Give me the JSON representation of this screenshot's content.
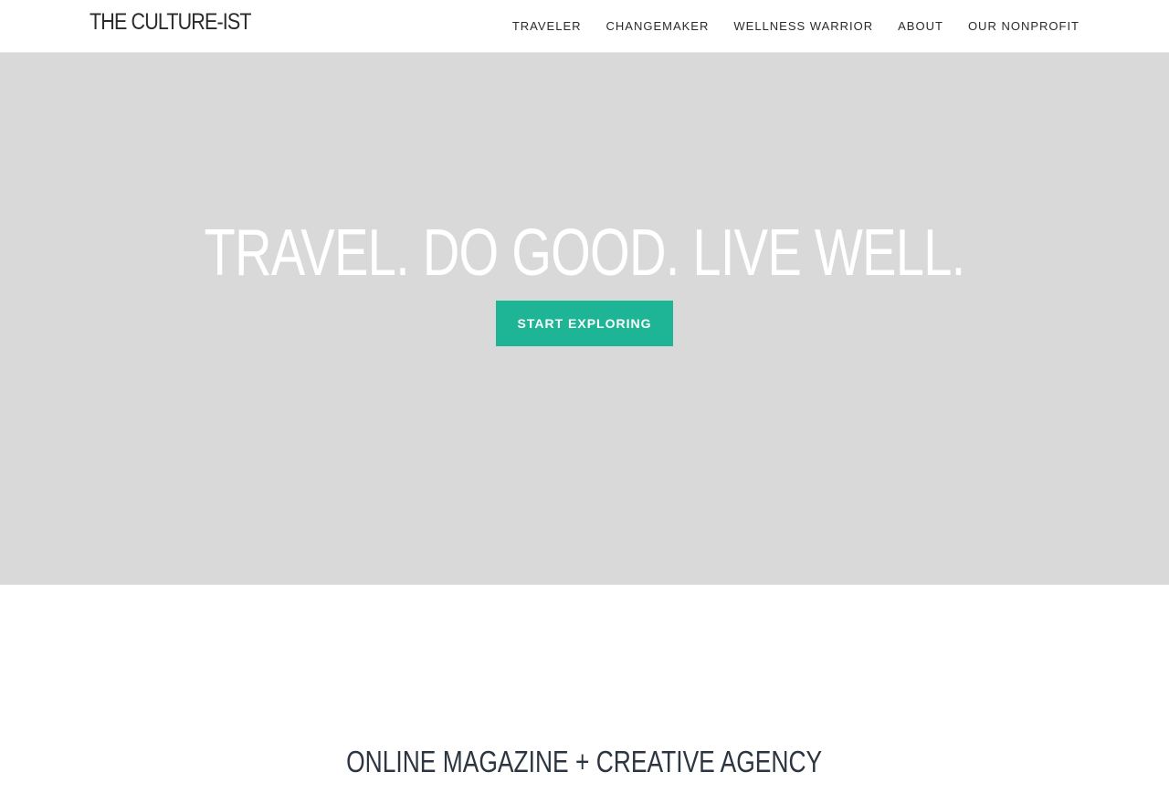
{
  "header": {
    "logo": "THE CULTURE-IST",
    "nav": [
      {
        "label": "TRAVELER"
      },
      {
        "label": "CHANGEMAKER"
      },
      {
        "label": "WELLNESS WARRIOR"
      },
      {
        "label": "ABOUT"
      },
      {
        "label": "OUR NONPROFIT"
      }
    ]
  },
  "hero": {
    "title": "TRAVEL. DO GOOD. LIVE WELL.",
    "cta_label": "START EXPLORING"
  },
  "section": {
    "tagline": "ONLINE MAGAZINE + CREATIVE AGENCY"
  },
  "colors": {
    "accent": "#1db596",
    "hero_bg": "#d9d9d9",
    "text_dark": "#2c3540"
  }
}
